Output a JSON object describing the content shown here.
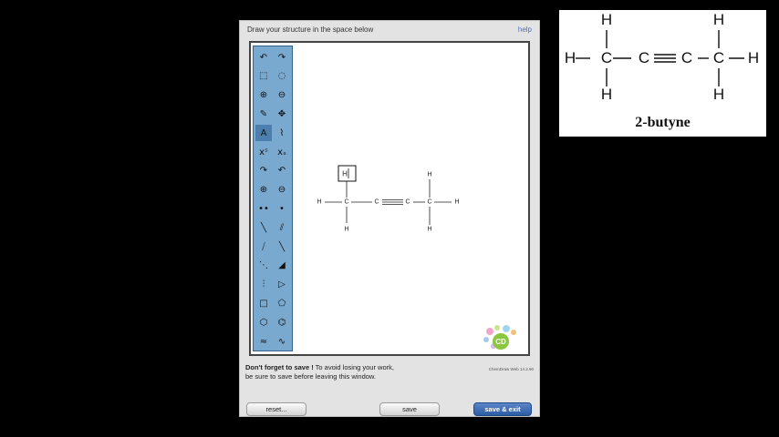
{
  "editor_panel": {
    "instruction": "Draw your structure in the space below",
    "help_link": "help",
    "save_note_bold": "Don't forget to save !",
    "save_note_line1": " To avoid losing your work,",
    "save_note_line2": "be sure to save before leaving this window.",
    "version": "ChemDraw Web 14.2.90",
    "buttons": {
      "reset": "reset...",
      "save": "save",
      "save_exit": "save & exit"
    },
    "logo_text": "CD",
    "colors": {
      "toolbar": "#7aa9cf",
      "save_exit": "#2d5ca4"
    }
  },
  "toolbar": {
    "tools": [
      {
        "name": "undo-icon",
        "glyph": "↶"
      },
      {
        "name": "redo-icon",
        "glyph": "↷"
      },
      {
        "name": "marquee-select-icon",
        "glyph": "⬚"
      },
      {
        "name": "lasso-select-icon",
        "glyph": "◌"
      },
      {
        "name": "zoom-in-icon",
        "glyph": "⊕"
      },
      {
        "name": "zoom-out-icon",
        "glyph": "⊖"
      },
      {
        "name": "eraser-icon",
        "glyph": "✎"
      },
      {
        "name": "move-icon",
        "glyph": "✥"
      },
      {
        "name": "text-tool-icon",
        "glyph": "A"
      },
      {
        "name": "chain-tool-icon",
        "glyph": "⌇"
      },
      {
        "name": "superscript-icon",
        "glyph": "xˢ"
      },
      {
        "name": "subscript-icon",
        "glyph": "xₛ"
      },
      {
        "name": "arrow-curved-left-icon",
        "glyph": "↷"
      },
      {
        "name": "arrow-curved-right-icon",
        "glyph": "↶"
      },
      {
        "name": "plus-charge-icon",
        "glyph": "⊕"
      },
      {
        "name": "minus-charge-icon",
        "glyph": "⊖"
      },
      {
        "name": "radical-pair-icon",
        "glyph": "••"
      },
      {
        "name": "radical-icon",
        "glyph": "•"
      },
      {
        "name": "single-bond-icon",
        "glyph": "╲"
      },
      {
        "name": "double-bond-icon",
        "glyph": "⫽"
      },
      {
        "name": "triple-bond-icon",
        "glyph": "⧸"
      },
      {
        "name": "bold-bond-icon",
        "glyph": "╲"
      },
      {
        "name": "dashed-bond-icon",
        "glyph": "⋱"
      },
      {
        "name": "wedge-bond-icon",
        "glyph": "◢"
      },
      {
        "name": "hashed-wedge-icon",
        "glyph": "⫶"
      },
      {
        "name": "arrow-tool-icon",
        "glyph": "▷"
      },
      {
        "name": "square-ring-icon",
        "glyph": "□"
      },
      {
        "name": "pentagon-ring-icon",
        "glyph": "⬠"
      },
      {
        "name": "hexagon-ring-icon",
        "glyph": "⬡"
      },
      {
        "name": "benzene-ring-icon",
        "glyph": "⌬"
      },
      {
        "name": "chain-zigzag-icon",
        "glyph": "≈"
      },
      {
        "name": "wavy-bond-icon",
        "glyph": "∿"
      }
    ],
    "selected": "text-tool-icon"
  },
  "canvas": {
    "atoms": {
      "h_left": "H",
      "c1": "C",
      "c2": "C",
      "c3": "C",
      "c4": "C",
      "h_right": "H",
      "h_c1_bottom": "H",
      "h_c4_top": "H",
      "h_c4_bottom": "H",
      "h_c1_top_editing": "H"
    }
  },
  "reference": {
    "labels": {
      "h_top_left": "H",
      "h_top_right": "H",
      "h_left": "H",
      "c1": "C",
      "c2": "C",
      "c3": "C",
      "c4": "C",
      "h_right": "H",
      "h_bottom_left": "H",
      "h_bottom_right": "H"
    },
    "caption": "2-butyne"
  }
}
